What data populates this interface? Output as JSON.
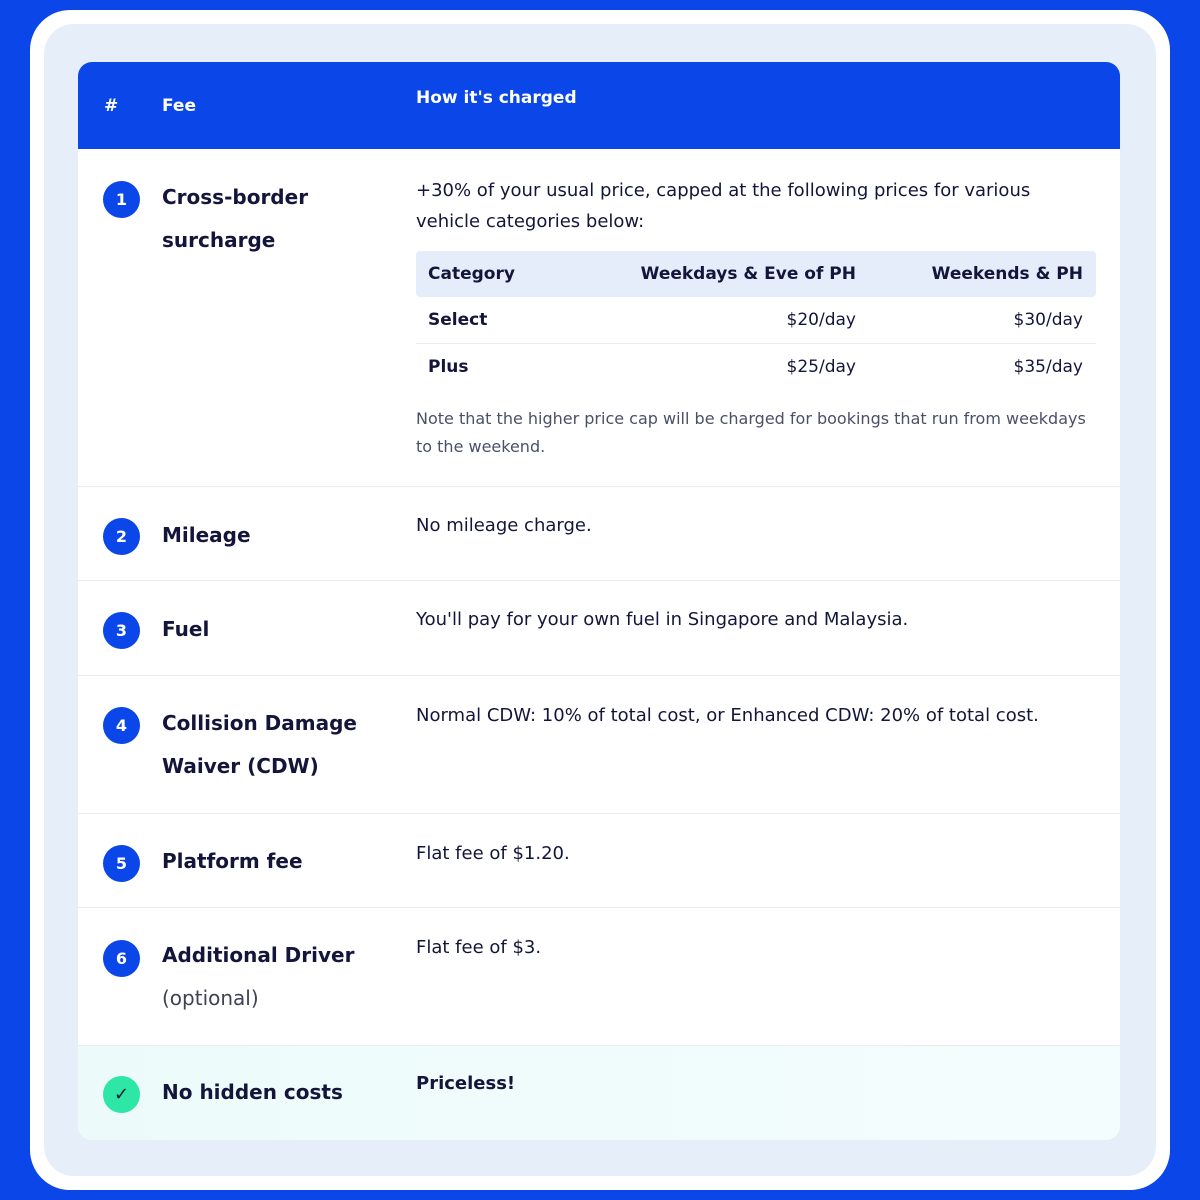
{
  "header": {
    "col_num": "#",
    "col_fee": "Fee",
    "col_how": "How it's charged"
  },
  "rows": [
    {
      "badge": "1",
      "fee": "Cross-border surcharge",
      "how": "+30% of your usual price, capped at the following prices for various vehicle categories below:",
      "subtable": {
        "headers": [
          "Category",
          "Weekdays & Eve of PH",
          "Weekends & PH"
        ],
        "rows": [
          [
            "Select",
            "$20/day",
            "$30/day"
          ],
          [
            "Plus",
            "$25/day",
            "$35/day"
          ]
        ]
      },
      "note": "Note that the higher price cap will be charged for bookings that run from weekdays to the weekend."
    },
    {
      "badge": "2",
      "fee": "Mileage",
      "how": "No mileage charge."
    },
    {
      "badge": "3",
      "fee": "Fuel",
      "how": "You'll pay for your own fuel in Singapore and Malaysia."
    },
    {
      "badge": "4",
      "fee": "Collision Damage Waiver (CDW)",
      "how": "Normal CDW: 10% of total cost, or Enhanced CDW: 20% of total cost."
    },
    {
      "badge": "5",
      "fee": "Platform fee",
      "how": "Flat fee of $1.20."
    },
    {
      "badge": "6",
      "fee": "Additional Driver",
      "fee_sub": "(optional)",
      "how": "Flat fee of $3."
    },
    {
      "badge": "✓",
      "fee": "No hidden costs",
      "how": "Priceless!"
    }
  ],
  "colors": {
    "brand_blue": "#0a46e8",
    "check_green": "#2ee6a6",
    "page_bg": "#e6eef9"
  },
  "icons": {
    "row7": "checkmark-icon"
  }
}
